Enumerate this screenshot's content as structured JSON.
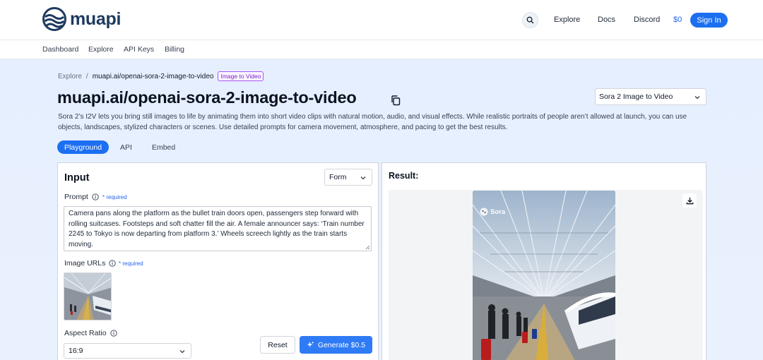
{
  "brand": {
    "name": "muapi"
  },
  "topnav": {
    "links": [
      "Explore",
      "Docs",
      "Discord"
    ],
    "balance": "$0",
    "signin_label": "Sign In"
  },
  "subnav": {
    "links": [
      "Dashboard",
      "Explore",
      "API Keys",
      "Billing"
    ]
  },
  "breadcrumb": {
    "root": "Explore",
    "separator": "/",
    "current": "muapi.ai/openai-sora-2-image-to-video",
    "badge": "Image to Video"
  },
  "page": {
    "title": "muapi.ai/openai-sora-2-image-to-video",
    "model_select_value": "Sora 2 Image to Video",
    "description": "Sora 2’s I2V lets you bring still images to life by animating them into short video clips with natural motion, audio, and visual effects. While realistic portraits of people aren’t allowed at launch, you can use objects, landscapes, stylized characters or scenes. Use detailed prompts for camera movement, atmosphere, and pacing to get the best results."
  },
  "tabs": [
    {
      "label": "Playground",
      "active": true
    },
    {
      "label": "API",
      "active": false
    },
    {
      "label": "Embed",
      "active": false
    }
  ],
  "input_panel": {
    "title": "Input",
    "mode_select_value": "Form",
    "prompt": {
      "label": "Prompt",
      "required": "* required",
      "value": "Camera pans along the platform as the bullet train doors open, passengers step forward with rolling suitcases. Footsteps and soft chatter fill the air. A female announcer says: ‘Train number 2245 to Tokyo is now departing from platform 3.’ Wheels screech lightly as the train starts moving."
    },
    "image_urls": {
      "label": "Image URLs",
      "required": "* required"
    },
    "aspect_ratio": {
      "label": "Aspect Ratio",
      "value": "16:9"
    },
    "reset_label": "Reset",
    "generate_label": "Generate $0.5"
  },
  "result_panel": {
    "title": "Result:",
    "watermark": "Sora"
  },
  "colors": {
    "accent": "#1d6ff2",
    "badge_border": "#a855f7",
    "required_text": "#2563eb",
    "main_background": "#e6efff"
  },
  "icons": [
    "logo-wave-icon",
    "search-icon",
    "copy-icon",
    "chevron-down-icon",
    "info-icon",
    "sparkle-icon",
    "download-icon",
    "sora-logo-icon"
  ]
}
